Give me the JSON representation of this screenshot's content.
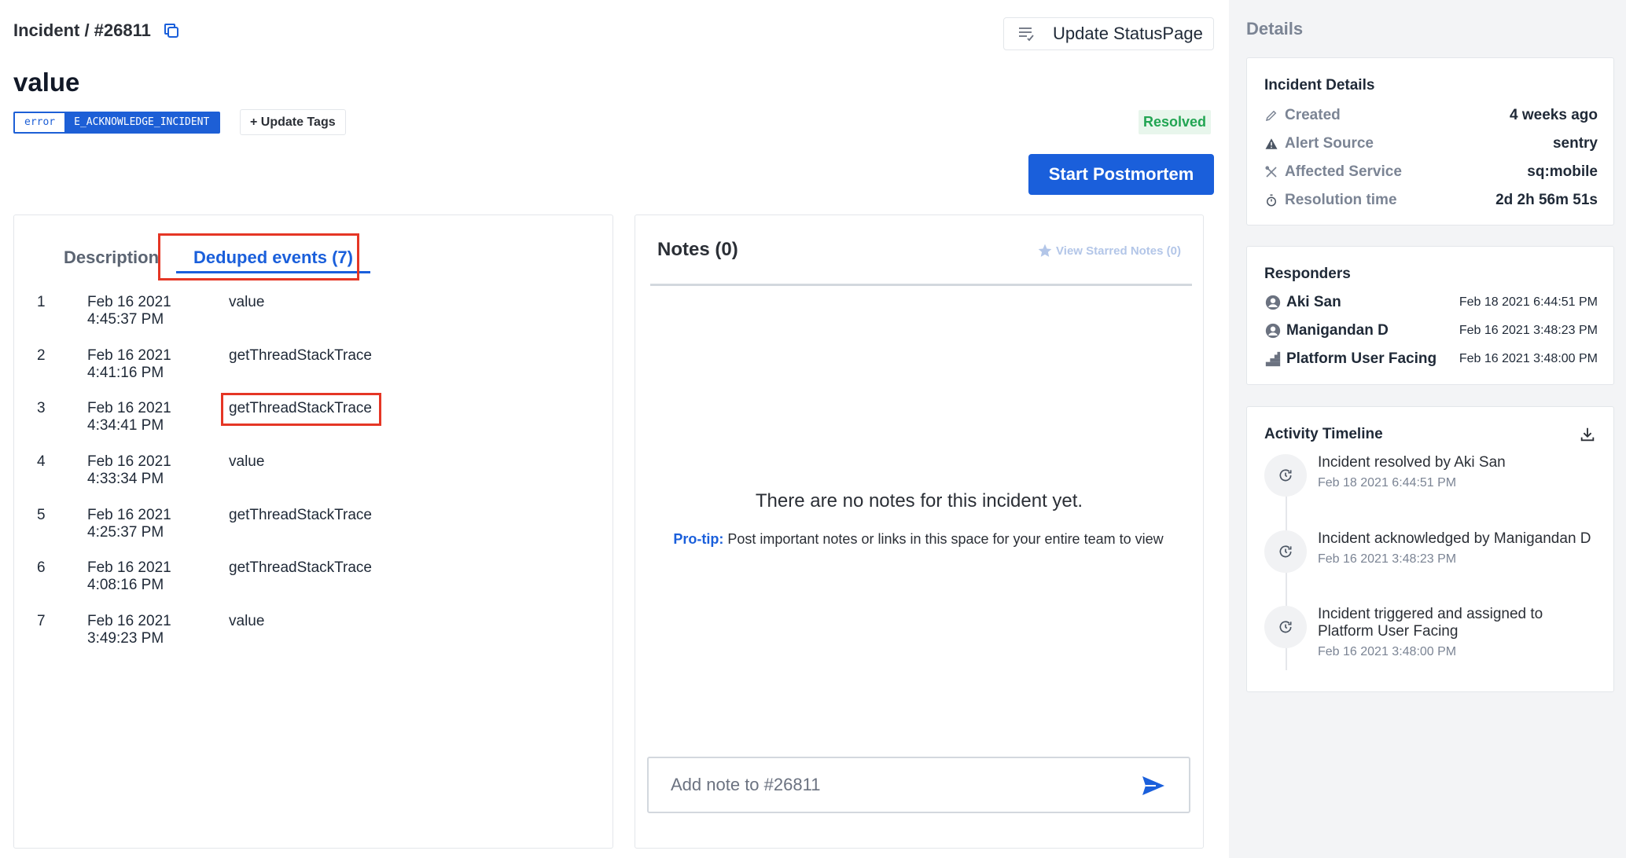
{
  "header": {
    "breadcrumb": "Incident / #26811",
    "update_statuspage_label": "Update StatusPage",
    "title": "value",
    "tag_key": "error",
    "tag_value": "E_ACKNOWLEDGE_INCIDENT",
    "update_tags_label": "+ Update Tags",
    "status": "Resolved",
    "postmortem_label": "Start Postmortem"
  },
  "tabs": [
    {
      "label": "Description",
      "active": false
    },
    {
      "label": "Deduped events (7)",
      "active": true
    }
  ],
  "events": [
    {
      "num": "1",
      "date": "Feb 16 2021",
      "time": "4:45:37 PM",
      "message": "value"
    },
    {
      "num": "2",
      "date": "Feb 16 2021",
      "time": "4:41:16 PM",
      "message": "getThreadStackTrace"
    },
    {
      "num": "3",
      "date": "Feb 16 2021",
      "time": "4:34:41 PM",
      "message": "getThreadStackTrace"
    },
    {
      "num": "4",
      "date": "Feb 16 2021",
      "time": "4:33:34 PM",
      "message": "value"
    },
    {
      "num": "5",
      "date": "Feb 16 2021",
      "time": "4:25:37 PM",
      "message": "getThreadStackTrace"
    },
    {
      "num": "6",
      "date": "Feb 16 2021",
      "time": "4:08:16 PM",
      "message": "getThreadStackTrace"
    },
    {
      "num": "7",
      "date": "Feb 16 2021",
      "time": "3:49:23 PM",
      "message": "value"
    }
  ],
  "notes": {
    "title": "Notes (0)",
    "starred_label": "View Starred Notes (0)",
    "empty_message": "There are no notes for this incident yet.",
    "protip_label": "Pro-tip:",
    "protip_text": " Post important notes or links in this space for your entire team to view",
    "input_placeholder": "Add note to #26811"
  },
  "sidebar": {
    "title": "Details",
    "incident_details": {
      "heading": "Incident Details",
      "rows": [
        {
          "key": "Created",
          "value": "4 weeks ago",
          "icon": "pencil-icon"
        },
        {
          "key": "Alert Source",
          "value": "sentry",
          "icon": "warning-icon"
        },
        {
          "key": "Affected Service",
          "value": "sq:mobile",
          "icon": "tools-icon"
        },
        {
          "key": "Resolution time",
          "value": "2d 2h 56m 51s",
          "icon": "stopwatch-icon"
        }
      ]
    },
    "responders": {
      "heading": "Responders",
      "items": [
        {
          "name": "Aki San",
          "time": "Feb 18 2021 6:44:51 PM",
          "icon": "user-icon"
        },
        {
          "name": "Manigandan D",
          "time": "Feb 16 2021 3:48:23 PM",
          "icon": "user-icon"
        },
        {
          "name": "Platform User Facing",
          "time": "Feb 16 2021 3:48:00 PM",
          "icon": "escalation-icon"
        }
      ]
    },
    "activity": {
      "heading": "Activity Timeline",
      "items": [
        {
          "text": "Incident resolved by Aki San",
          "time": "Feb 18 2021 6:44:51 PM"
        },
        {
          "text": "Incident acknowledged by Manigandan D",
          "time": "Feb 16 2021 3:48:23 PM"
        },
        {
          "text": "Incident triggered and assigned to Platform User Facing",
          "time": "Feb 16 2021 3:48:00 PM"
        }
      ]
    }
  },
  "colors": {
    "accent": "#1a5fdb",
    "highlight": "#e53625",
    "resolved": "#22a553"
  }
}
